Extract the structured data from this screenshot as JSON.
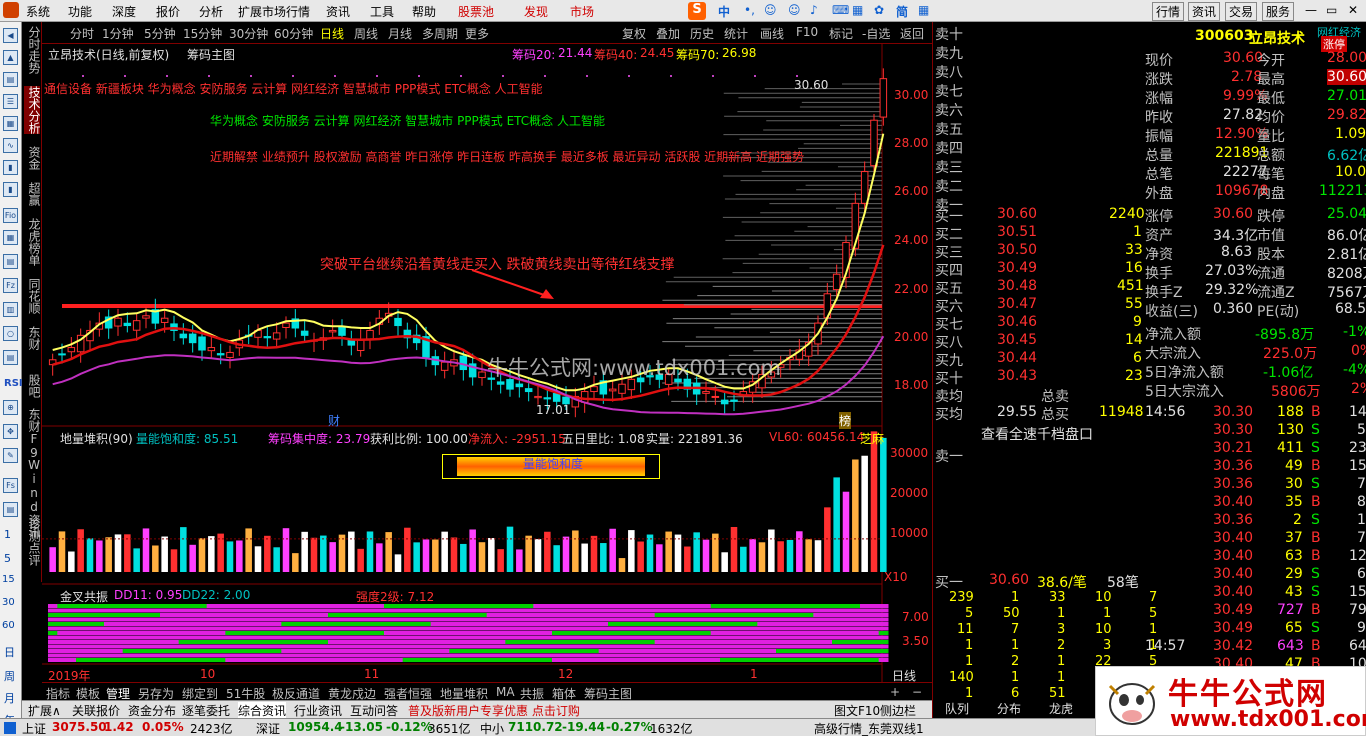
{
  "menu": {
    "items": [
      "系统",
      "功能",
      "深度",
      "报价",
      "分析",
      "扩展市场行情",
      "资讯",
      "工具",
      "帮助"
    ],
    "red_items": [
      "股票池",
      "发现",
      "市场"
    ],
    "right_items": [
      "行情",
      "资讯",
      "交易",
      "服务"
    ],
    "ime": [
      "中",
      "简"
    ]
  },
  "toolbar": {
    "periods": [
      "分时",
      "1分钟",
      "5分钟",
      "15分钟",
      "30分钟",
      "60分钟",
      "日线",
      "周线",
      "月线",
      "多周期",
      "更多"
    ],
    "selected": "日线",
    "tools": [
      "复权",
      "叠加",
      "历史",
      "统计",
      "画线",
      "F10",
      "标记",
      "-自选",
      "返回"
    ]
  },
  "left_vtabs": [
    "分时走势",
    "技术分析",
    "资金",
    "超赢",
    "龙虎榜单",
    "同花顺",
    "东财",
    "股吧",
    "东财F9",
    "Wind资讯",
    "诊测点评"
  ],
  "left_icons": [
    "RSI",
    "Fs",
    "Fz",
    "Fio"
  ],
  "left_dates": [
    "1",
    "5",
    "15",
    "30",
    "60",
    "日",
    "周",
    "月",
    "年"
  ],
  "main_chart": {
    "title": "立昂技术(日线,前复权)",
    "main_indicator": "筹码主图",
    "chip_labels": [
      [
        "筹码20:",
        "21.44"
      ],
      [
        "筹码40:",
        "24.45"
      ],
      [
        "筹码70:",
        "26.98"
      ]
    ],
    "concepts_line1": "通信设备 新疆板块 华为概念 安防服务 云计算 网红经济 智慧城市 PPP模式 ETC概念 人工智能",
    "concepts_line2": "华为概念 安防服务 云计算 网红经济 智慧城市 PPP模式 ETC概念 人工智能",
    "concepts_line3": "近期解禁 业绩预升 股权激励 高商誉 昨日涨停 昨日连板 昨高换手 最近多板 最近异动 活跃股 近期新高 近期强势",
    "annotation": "突破平台继续沿着黄线走买入 跌破黄线卖出等待红线支撑",
    "watermark": "牛牛公式网:www.tdx001.com",
    "high_label": "30.60",
    "low_label": "17.01",
    "marker_cai": "财",
    "marker_bang": "榜",
    "y_ticks": [
      "30.00",
      "28.00",
      "26.00",
      "24.00",
      "22.00",
      "20.00",
      "18.00"
    ]
  },
  "chart_data": {
    "type": "candlestick",
    "price_axis": [
      18.0,
      30.0
    ],
    "closes": [
      19.1,
      19.3,
      19.6,
      20.1,
      20.3,
      20.6,
      20.4,
      20.8,
      20.5,
      20.7,
      20.9,
      20.6,
      20.8,
      20.3,
      20.0,
      19.8,
      19.5,
      19.6,
      19.3,
      19.4,
      19.9,
      20.1,
      20.3,
      20.0,
      20.2,
      20.6,
      20.4,
      20.1,
      19.9,
      20.0,
      20.3,
      20.1,
      19.7,
      19.9,
      20.3,
      20.8,
      21.0,
      20.5,
      20.0,
      19.8,
      19.2,
      18.9,
      19.0,
      19.1,
      18.7,
      18.4,
      18.6,
      18.3,
      18.1,
      17.9,
      18.0,
      17.8,
      17.6,
      17.5,
      17.4,
      17.3,
      17.6,
      17.8,
      18.0,
      17.7,
      17.9,
      18.1,
      18.3,
      18.2,
      18.4,
      18.3,
      18.5,
      18.2,
      17.9,
      17.7,
      17.8,
      17.6,
      17.3,
      17.4,
      17.8,
      18.2,
      18.5,
      18.6,
      18.9,
      19.2,
      19.5,
      19.8,
      20.6,
      21.8,
      22.6,
      23.9,
      25.5,
      26.8,
      28.9,
      30.6
    ],
    "volume_axis": [
      0,
      30000
    ],
    "volume_ticks": [
      "30000",
      "20000",
      "10000"
    ],
    "cross_ticks": [
      "7.00",
      "3.50"
    ],
    "x_ticks": [
      "2019年",
      "10",
      "11",
      "12",
      "1"
    ]
  },
  "volume_panel": {
    "title": "地量堆积(90)",
    "label1": "量能饱和度: 85.51",
    "label2": "筹码集中度: 23.79",
    "label3": "获利比例: 100.00",
    "label4": "净流入: -2951.15",
    "label5": "五日里比: 1.08",
    "label6": "实量: 221891.36",
    "label7": "VL60: 60456.14",
    "label8": "芝麻",
    "box": "量能饱和度",
    "x10": "X10"
  },
  "cross_panel": {
    "title": "金叉共振",
    "dd11": "DD11: 0.95",
    "dd22": "DD22: 2.00",
    "strength": "强度2级: 7.12"
  },
  "bottom_tabs": [
    "指标",
    "模板",
    "管理",
    "另存为",
    "绑定到",
    "51牛股",
    "极反通道",
    "黄龙戍边",
    "强者恒强",
    "地量堆积",
    "MA",
    "共振",
    "箱体",
    "筹码主图"
  ],
  "bottom_tabs2": [
    "扩展∧",
    "关联报价",
    "资金分布",
    "逐笔委托",
    "综合资讯",
    "行业资讯",
    "互动问答",
    "普及版新用户专享优惠 点击订购",
    "图文F10",
    "侧边栏"
  ],
  "period_small": "日线",
  "quote": {
    "code": "300603",
    "name": "立昂技术",
    "tag": "网红经济",
    "limit": "涨停",
    "fields": [
      [
        "现价",
        "30.60",
        "今开",
        "28.00"
      ],
      [
        "涨跌",
        "2.78",
        "最高",
        "30.60"
      ],
      [
        "涨幅",
        "9.99%",
        "最低",
        "27.01"
      ],
      [
        "昨收",
        "27.82",
        "均价",
        "29.82"
      ],
      [
        "振幅",
        "12.90%",
        "量比",
        "1.09"
      ],
      [
        "总量",
        "221891",
        "总额",
        "6.62亿"
      ],
      [
        "总笔",
        "22277",
        "每笔",
        "10.0"
      ],
      [
        "外盘",
        "109678",
        "内盘",
        "112213"
      ]
    ],
    "sell_levels": [
      "卖十",
      "卖九",
      "卖八",
      "卖七",
      "卖六",
      "卖五",
      "卖四",
      "卖三",
      "卖二",
      "卖一"
    ],
    "buy_levels": [
      [
        "买一",
        "30.60",
        "2240"
      ],
      [
        "买二",
        "30.51",
        "1"
      ],
      [
        "买三",
        "30.50",
        "33"
      ],
      [
        "买四",
        "30.49",
        "16"
      ],
      [
        "买五",
        "30.48",
        "451"
      ],
      [
        "买六",
        "30.47",
        "55"
      ],
      [
        "买七",
        "30.46",
        "9"
      ],
      [
        "买八",
        "30.45",
        "14"
      ],
      [
        "买九",
        "30.44",
        "6"
      ],
      [
        "买十",
        "30.43",
        "23"
      ]
    ],
    "sell_avg": [
      "卖均",
      "",
      "总卖",
      ""
    ],
    "buy_avg": [
      "买均",
      "29.55",
      "总买",
      "11948"
    ],
    "full_depth": "查看全速千档盘口",
    "sell1": "卖一",
    "buy1": [
      "买一",
      "30.60",
      "38.6/笔",
      "58笔"
    ],
    "stats": [
      [
        "涨停",
        "30.60",
        "跌停",
        "25.04"
      ],
      [
        "资产",
        "34.3亿",
        "市值",
        "86.0亿"
      ],
      [
        "净资",
        "8.63",
        "股本",
        "2.81亿"
      ],
      [
        "换手",
        "27.03%",
        "流通",
        "8208万"
      ],
      [
        "换手Z",
        "29.32%",
        "流通Z",
        "7567万"
      ],
      [
        "收益(三)",
        "0.360",
        "PE(动)",
        "68.5"
      ]
    ],
    "flows": [
      [
        "净流入额",
        "-895.8万",
        "-1%"
      ],
      [
        "大宗流入",
        "225.0万",
        "0%"
      ],
      [
        "5日净流入额",
        "-1.06亿",
        "-4%"
      ],
      [
        "5日大宗流入",
        "5806万",
        "2%"
      ]
    ],
    "ticks_time1": "14:56",
    "ticks1": [
      [
        "30.30",
        "188",
        "B",
        "14"
      ],
      [
        "30.30",
        "130",
        "S",
        "5"
      ],
      [
        "30.21",
        "411",
        "S",
        "23"
      ],
      [
        "30.36",
        "49",
        "B",
        "15"
      ],
      [
        "30.36",
        "30",
        "S",
        "7"
      ],
      [
        "30.40",
        "35",
        "B",
        "8"
      ],
      [
        "30.36",
        "2",
        "S",
        "1"
      ],
      [
        "30.40",
        "37",
        "B",
        "7"
      ],
      [
        "30.40",
        "63",
        "B",
        "12"
      ],
      [
        "30.40",
        "29",
        "S",
        "6"
      ],
      [
        "30.40",
        "43",
        "S",
        "15"
      ],
      [
        "30.49",
        "727",
        "B",
        "79"
      ],
      [
        "30.49",
        "65",
        "S",
        "9"
      ]
    ],
    "ticks_time2": "14:57",
    "ticks2": [
      [
        "30.42",
        "643",
        "B",
        "64"
      ],
      [
        "30.40",
        "47",
        "B",
        "10"
      ]
    ],
    "order_grid": [
      [
        "239",
        "1",
        "33",
        "10",
        "7"
      ],
      [
        "5",
        "50",
        "1",
        "1",
        "5"
      ],
      [
        "11",
        "7",
        "3",
        "10",
        "1"
      ],
      [
        "1",
        "1",
        "2",
        "3",
        "1"
      ],
      [
        "1",
        "2",
        "1",
        "22",
        "5"
      ],
      [
        "140",
        "1",
        "1",
        "",
        ""
      ],
      [
        "1",
        "6",
        "51",
        "",
        ""
      ]
    ],
    "bottom_tabs": [
      "队列",
      "分布",
      "龙虎"
    ]
  },
  "status": {
    "sh": [
      "上证",
      "3075.50",
      "1.42",
      "0.05%",
      "2423亿"
    ],
    "sz": [
      "深证",
      "10954.4",
      "-13.05",
      "-0.12%",
      "3651亿"
    ],
    "zx": [
      "中小",
      "7110.72",
      "-19.44",
      "-0.27%",
      "1632亿"
    ],
    "right": "高级行情_东莞双线1"
  },
  "logo": {
    "text": "牛牛公式网",
    "url": "www.tdx001.com"
  }
}
